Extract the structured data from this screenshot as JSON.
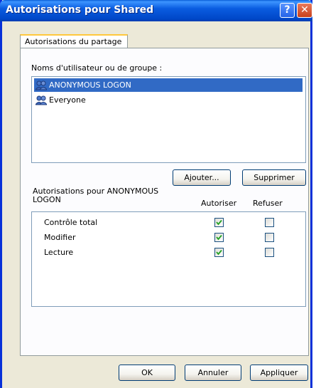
{
  "window": {
    "title": "Autorisations pour Shared",
    "help": "?",
    "close": "✕"
  },
  "tabs": [
    {
      "label": "Autorisations du partage",
      "active": true
    }
  ],
  "users_label": "Noms d'utilisateur ou de groupe :",
  "users": [
    {
      "name": "ANONYMOUS LOGON",
      "selected": true
    },
    {
      "name": "Everyone",
      "selected": false
    }
  ],
  "buttons": {
    "add": "Ajouter...",
    "remove": "Supprimer",
    "ok": "OK",
    "cancel": "Annuler",
    "apply": "Appliquer"
  },
  "perm_label": "Autorisations pour ANONYMOUS LOGON",
  "perm_label_line1": "Autorisations pour ANONYMOUS",
  "perm_label_line2": "LOGON",
  "columns": {
    "allow": "Autoriser",
    "deny": "Refuser"
  },
  "permissions": [
    {
      "name": "Contrôle total",
      "allow": true,
      "deny": false
    },
    {
      "name": "Modifier",
      "allow": true,
      "deny": false
    },
    {
      "name": "Lecture",
      "allow": true,
      "deny": false
    }
  ]
}
